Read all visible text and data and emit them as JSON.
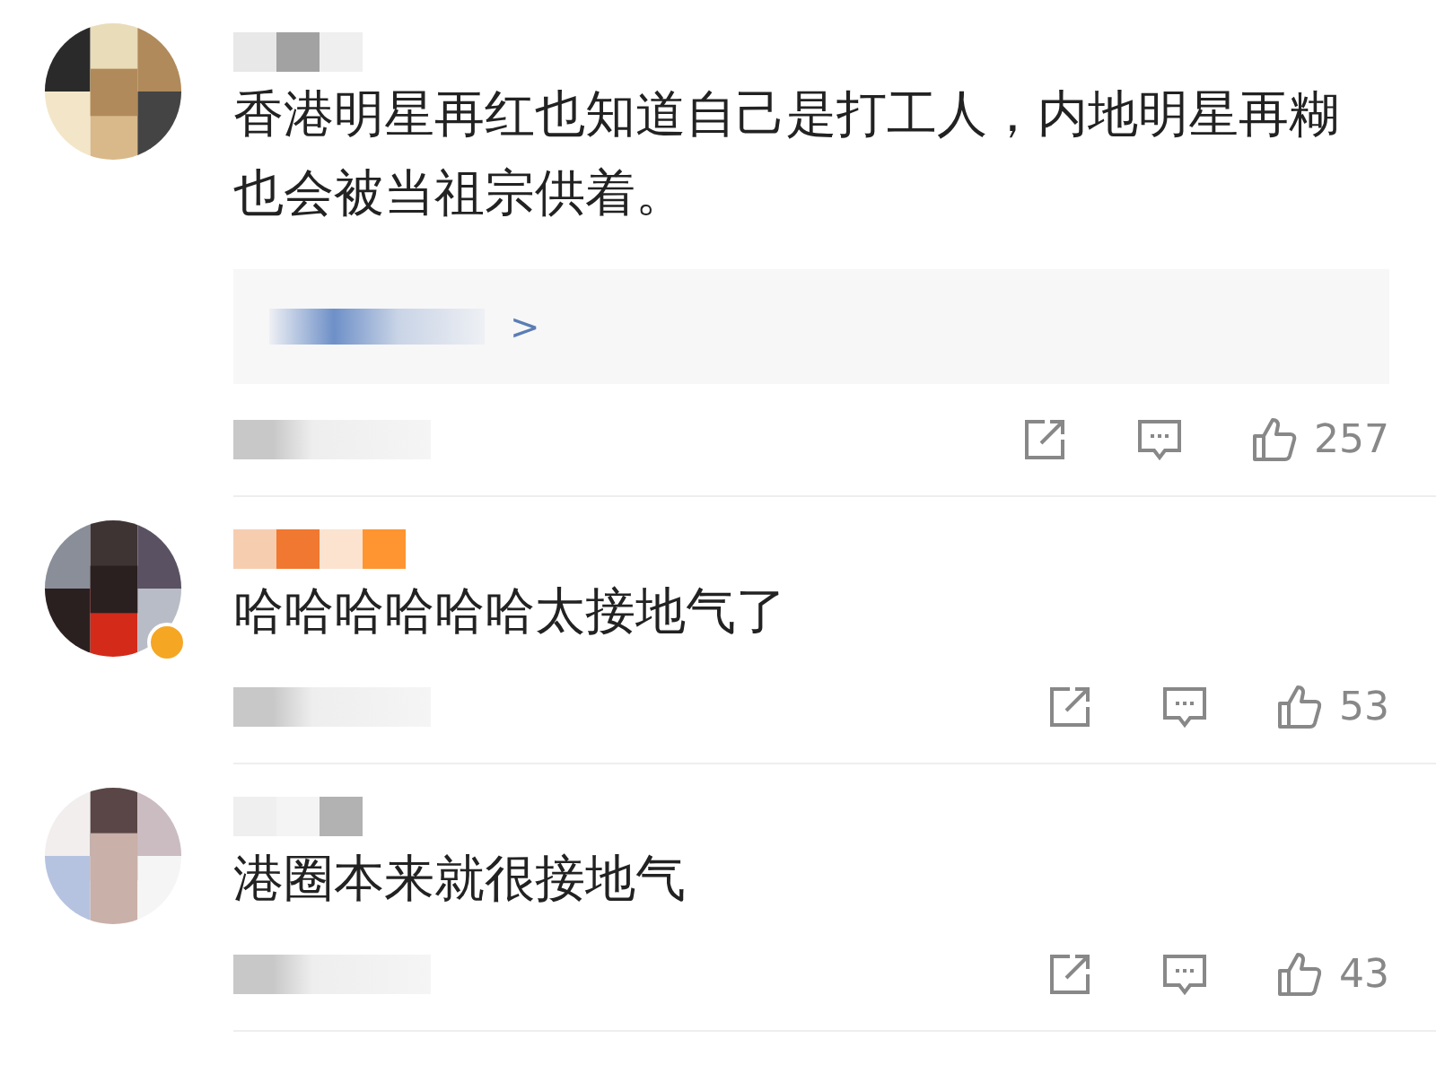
{
  "comments": [
    {
      "text": "香港明星再红也知道自己是打工人，内地明星再糊也会被当祖宗供着。",
      "verified": false,
      "replies": {
        "arrow": ">"
      },
      "likes": "257"
    },
    {
      "text": "哈哈哈哈哈哈太接地气了",
      "verified": true,
      "likes": "53"
    },
    {
      "text": "港圈本来就很接地气",
      "verified": false,
      "likes": "43"
    }
  ]
}
